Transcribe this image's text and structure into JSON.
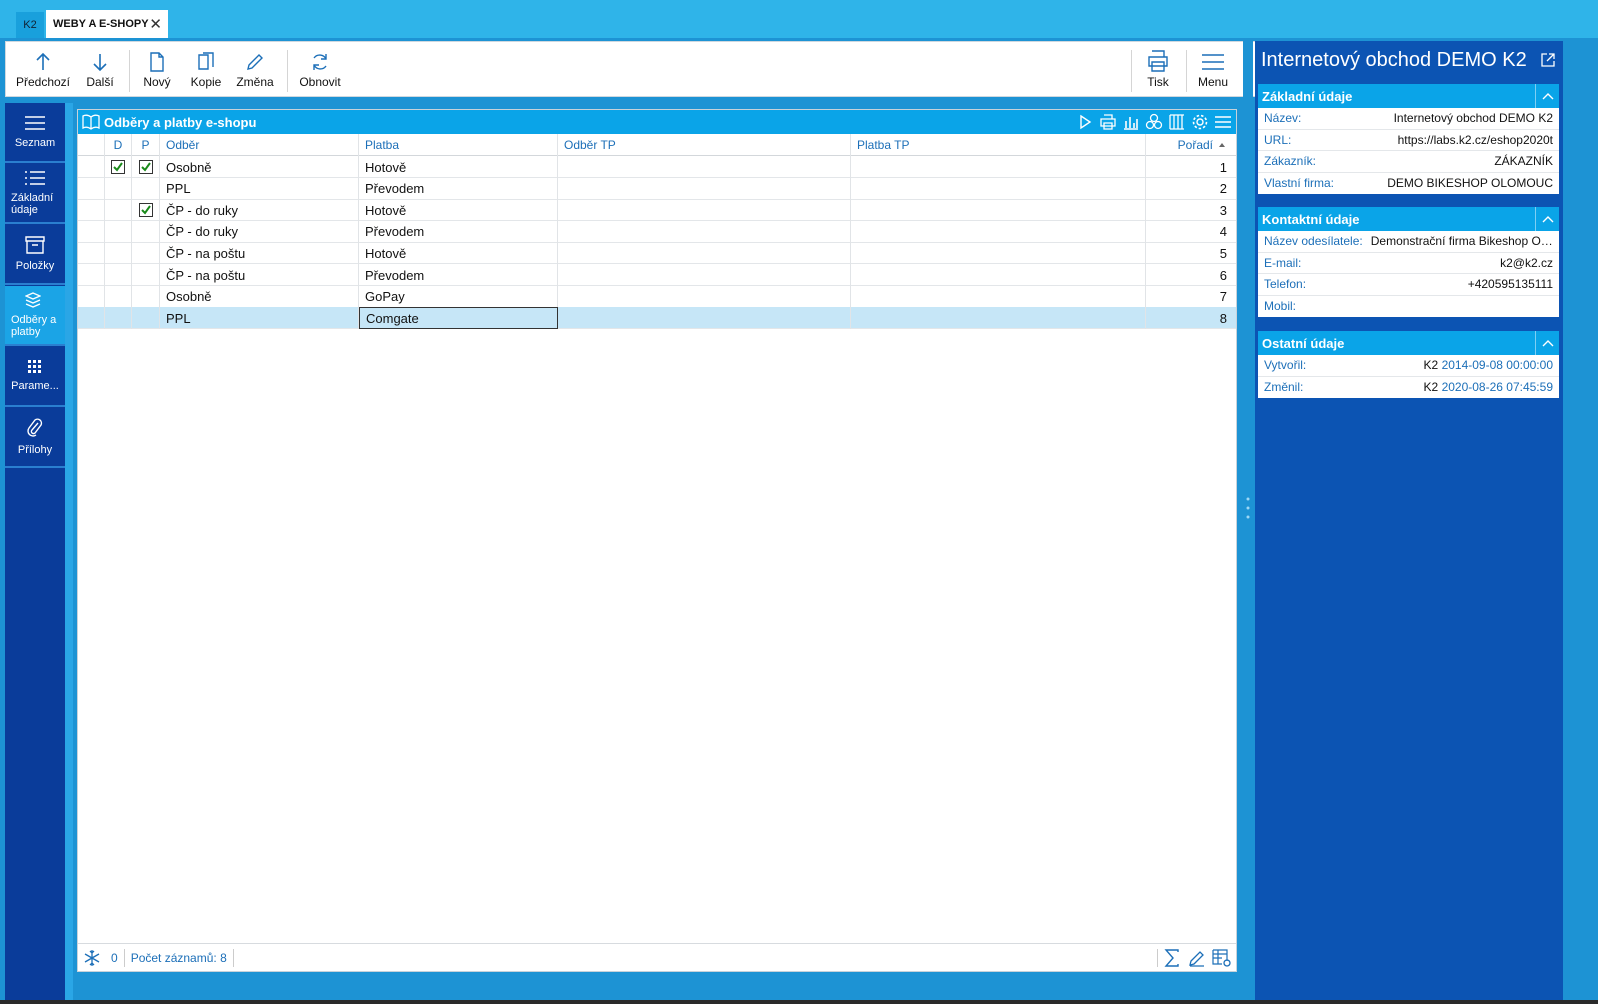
{
  "titlebar": {
    "k2_label": "K2",
    "tab_label": "WEBY A E-SHOPY",
    "close_glyph": "✕"
  },
  "toolbar": {
    "prev": "Předchozí",
    "next": "Další",
    "new": "Nový",
    "copy": "Kopie",
    "edit": "Změna",
    "refresh": "Obnovit",
    "print": "Tisk",
    "menu": "Menu"
  },
  "nav": {
    "list": "Seznam",
    "basic_1": "Základní",
    "basic_2": "údaje",
    "items": "Položky",
    "shipping_1": "Odběry a",
    "shipping_2": "platby",
    "params": "Parame...",
    "attachments": "Přílohy"
  },
  "panel": {
    "title": "Odběry a platby e-shopu"
  },
  "grid": {
    "headers": {
      "d": "D",
      "p": "P",
      "odber": "Odběr",
      "platba": "Platba",
      "odber_tp": "Odběr TP",
      "platba_tp": "Platba TP",
      "poradi": "Pořadí"
    },
    "rows": [
      {
        "d": true,
        "p": true,
        "odber": "Osobně",
        "platba": "Hotově",
        "odber_tp": "",
        "platba_tp": "",
        "poradi": "1"
      },
      {
        "d": false,
        "p": false,
        "odber": "PPL",
        "platba": "Převodem",
        "odber_tp": "",
        "platba_tp": "",
        "poradi": "2"
      },
      {
        "d": false,
        "p": true,
        "odber": "ČP - do ruky",
        "platba": "Hotově",
        "odber_tp": "",
        "platba_tp": "",
        "poradi": "3"
      },
      {
        "d": false,
        "p": false,
        "odber": "ČP - do ruky",
        "platba": "Převodem",
        "odber_tp": "",
        "platba_tp": "",
        "poradi": "4"
      },
      {
        "d": false,
        "p": false,
        "odber": "ČP - na poštu",
        "platba": "Hotově",
        "odber_tp": "",
        "platba_tp": "",
        "poradi": "5"
      },
      {
        "d": false,
        "p": false,
        "odber": "ČP - na poštu",
        "platba": "Převodem",
        "odber_tp": "",
        "platba_tp": "",
        "poradi": "6"
      },
      {
        "d": false,
        "p": false,
        "odber": "Osobně",
        "platba": "GoPay",
        "odber_tp": "",
        "platba_tp": "",
        "poradi": "7"
      },
      {
        "d": false,
        "p": false,
        "odber": "PPL",
        "platba": "Comgate",
        "odber_tp": "",
        "platba_tp": "",
        "poradi": "8"
      }
    ],
    "selected_row": 7
  },
  "footer": {
    "count": "0",
    "records": "Počet záznamů: 8"
  },
  "right": {
    "title": "Internetový obchod DEMO K2",
    "basic": {
      "header": "Základní údaje",
      "name_label": "Název:",
      "name_value": "Internetový obchod DEMO K2",
      "url_label": "URL:",
      "url_value": "https://labs.k2.cz/eshop2020t",
      "customer_label": "Zákazník:",
      "customer_value": "ZÁKAZNÍK",
      "firm_label": "Vlastní firma:",
      "firm_value": "DEMO BIKESHOP OLOMOUC"
    },
    "contact": {
      "header": "Kontaktní údaje",
      "sender_label": "Název odesílatele:",
      "sender_value": "Demonstrační firma Bikeshop Olo...",
      "email_label": "E-mail:",
      "email_value": "k2@k2.cz",
      "phone_label": "Telefon:",
      "phone_value": "+420595135111",
      "mobile_label": "Mobil:",
      "mobile_value": ""
    },
    "other": {
      "header": "Ostatní údaje",
      "created_label": "Vytvořil:",
      "created_user": "K2",
      "created_ts": "2014-09-08 00:00:00",
      "changed_label": "Změnil:",
      "changed_user": "K2",
      "changed_ts": "2020-08-26 07:45:59"
    }
  },
  "colors": {
    "accent": "#0aa4e8",
    "nav": "#0a3c9a",
    "right_panel": "#0c54b3",
    "label": "#1c6fb8",
    "selection": "#c6e6f7"
  }
}
